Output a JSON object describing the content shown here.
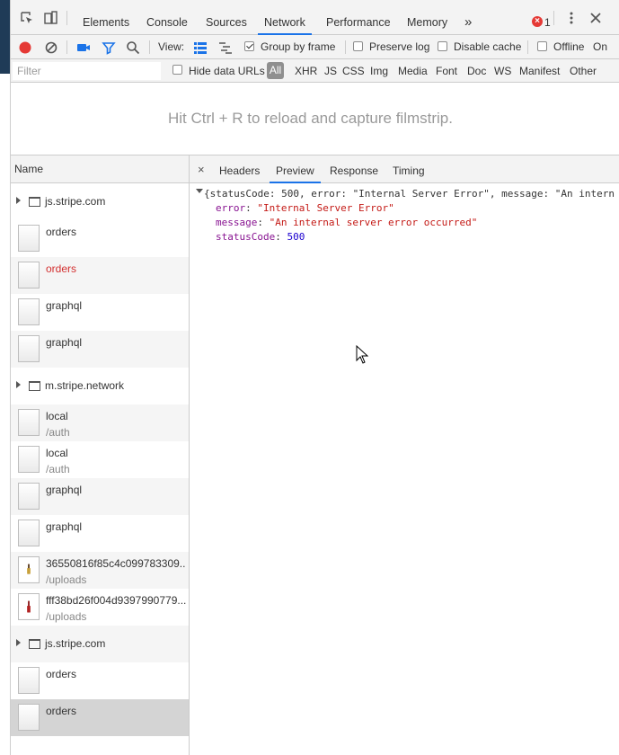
{
  "tabs": {
    "elements": "Elements",
    "console": "Console",
    "sources": "Sources",
    "network": "Network",
    "performance": "Performance",
    "memory": "Memory",
    "more": "»",
    "error_count": "1"
  },
  "toolbar": {
    "view_label": "View:",
    "group_by_frame": "Group by frame",
    "preserve_log": "Preserve log",
    "disable_cache": "Disable cache",
    "offline": "Offline",
    "online": "On"
  },
  "filter": {
    "placeholder": "Filter",
    "hide_data_urls": "Hide data URLs",
    "all": "All",
    "types": [
      "XHR",
      "JS",
      "CSS",
      "Img",
      "Media",
      "Font",
      "Doc",
      "WS",
      "Manifest",
      "Other"
    ]
  },
  "filmstrip": {
    "message": "Hit Ctrl + R to reload and capture filmstrip."
  },
  "requests": {
    "header": "Name",
    "rows": [
      {
        "kind": "group",
        "name": "js.stripe.com"
      },
      {
        "kind": "request",
        "name": "orders",
        "sub": ""
      },
      {
        "kind": "request",
        "name": "orders",
        "sub": "",
        "error": true
      },
      {
        "kind": "request",
        "name": "graphql",
        "sub": ""
      },
      {
        "kind": "request",
        "name": "graphql",
        "sub": ""
      },
      {
        "kind": "group",
        "name": "m.stripe.network"
      },
      {
        "kind": "request",
        "name": "local",
        "sub": "/auth"
      },
      {
        "kind": "request",
        "name": "local",
        "sub": "/auth"
      },
      {
        "kind": "request",
        "name": "graphql",
        "sub": ""
      },
      {
        "kind": "request",
        "name": "graphql",
        "sub": ""
      },
      {
        "kind": "request",
        "name": "36550816f85c4c099783309...",
        "sub": "/uploads",
        "image": true
      },
      {
        "kind": "request",
        "name": "fff38bd26f004d9397990779...",
        "sub": "/uploads",
        "image": true
      },
      {
        "kind": "group",
        "name": "js.stripe.com"
      },
      {
        "kind": "request",
        "name": "orders",
        "sub": ""
      },
      {
        "kind": "request",
        "name": "orders",
        "sub": "",
        "selected": true
      }
    ]
  },
  "details": {
    "close": "×",
    "tabs": [
      "Headers",
      "Preview",
      "Response",
      "Timing"
    ],
    "preview": {
      "summary": "{statusCode: 500, error: \"Internal Server Error\", message: \"An intern",
      "error_key": "error",
      "error_value": "\"Internal Server Error\"",
      "message_key": "message",
      "message_value": "\"An internal server error occurred\"",
      "status_key": "statusCode",
      "status_value": "500"
    }
  },
  "colors": {
    "accent": "#1a73e8",
    "error": "#d32f2f",
    "record": "#e53935"
  }
}
